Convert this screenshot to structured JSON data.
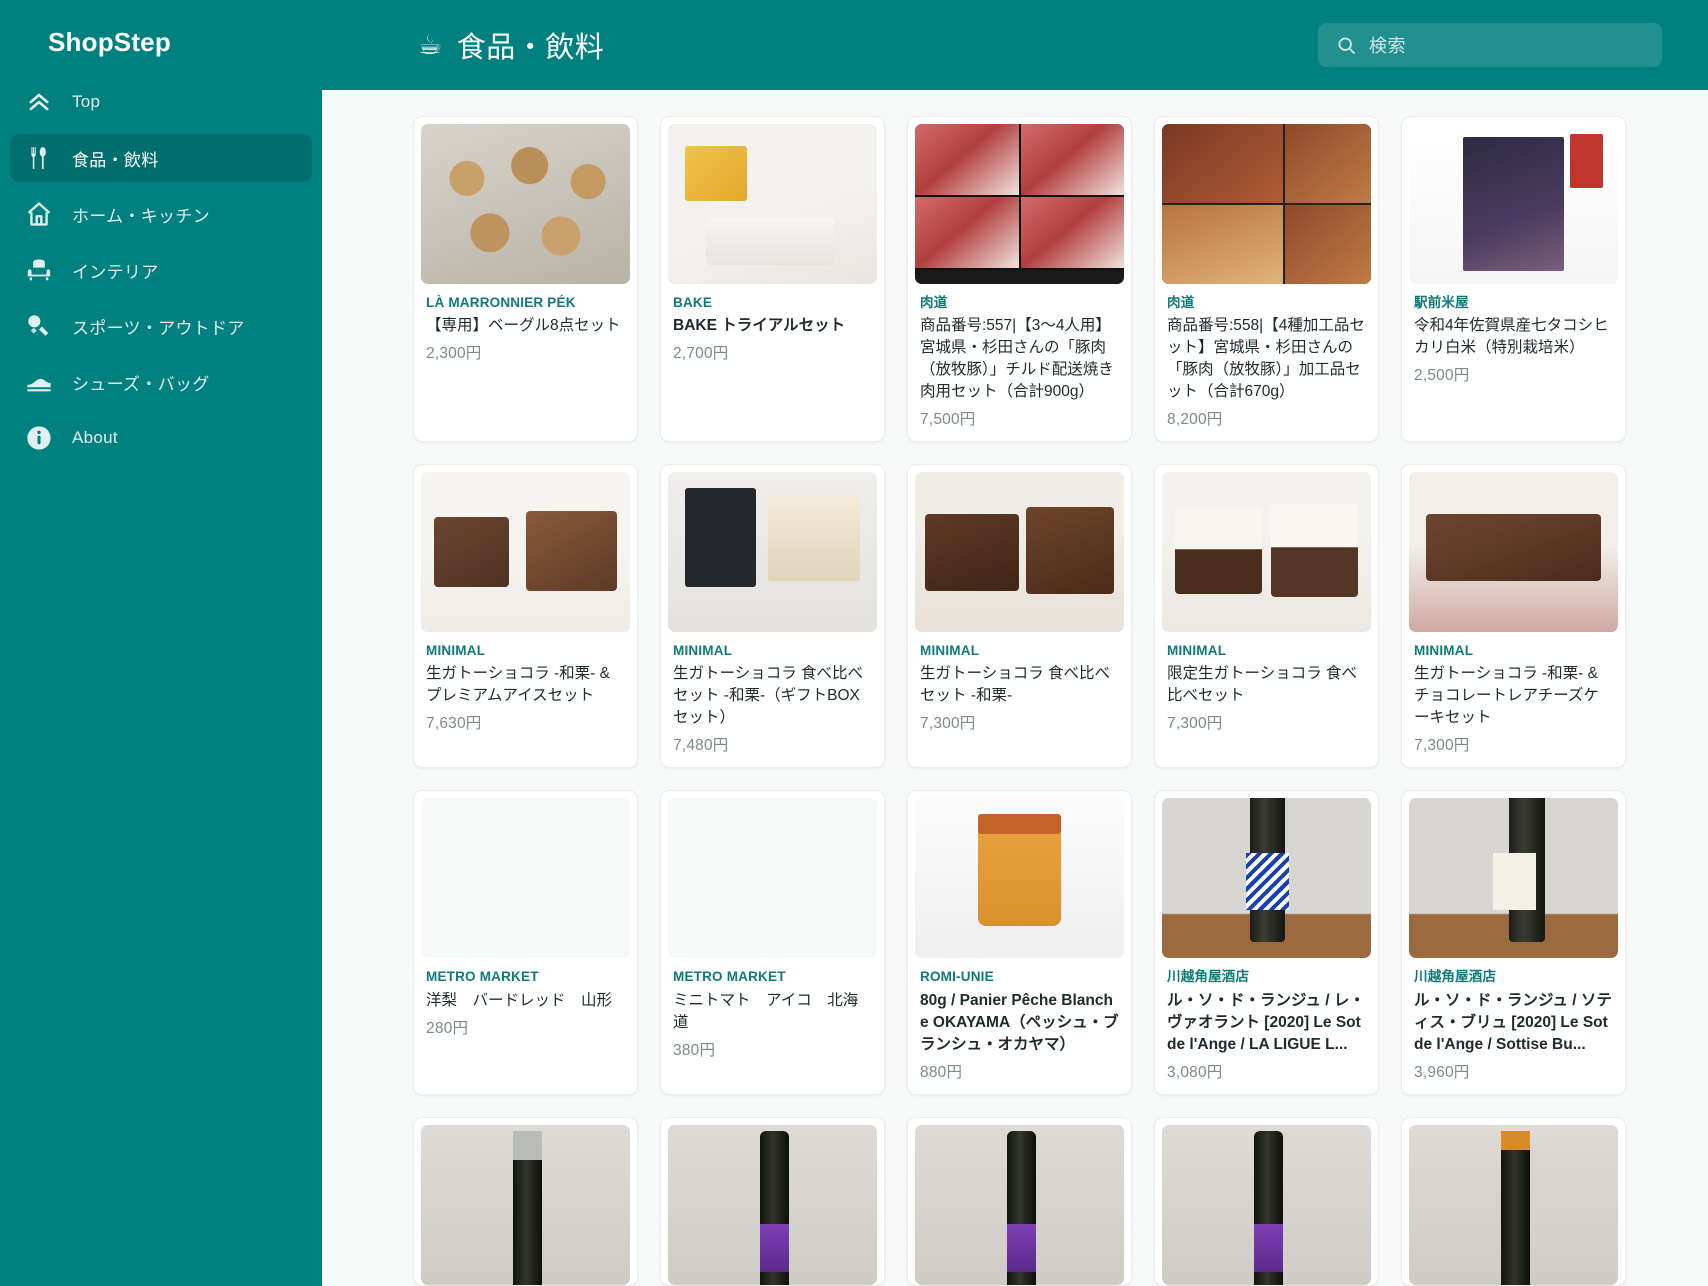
{
  "sidebar": {
    "brand": "ShopStep",
    "items": [
      {
        "label": "Top",
        "icon": "chevrons-up-icon",
        "active": false
      },
      {
        "label": "食品・飲料",
        "icon": "fork-spoon-icon",
        "active": true
      },
      {
        "label": "ホーム・キッチン",
        "icon": "home-icon",
        "active": false
      },
      {
        "label": "インテリア",
        "icon": "armchair-icon",
        "active": false
      },
      {
        "label": "スポーツ・アウトドア",
        "icon": "sports-icon",
        "active": false
      },
      {
        "label": "シューズ・バッグ",
        "icon": "shoe-icon",
        "active": false
      },
      {
        "label": "About",
        "icon": "info-icon",
        "active": false
      }
    ]
  },
  "header": {
    "title": "食品・飲料",
    "title_emoji": "☕",
    "search": {
      "placeholder": "検索",
      "value": "",
      "icon": "search-icon"
    }
  },
  "products": [
    {
      "shop": "LÀ MARRONNIER PÉK",
      "name": "【専用】ベーグル8点セット",
      "price": "2,300円",
      "bold": false,
      "art": "bagels"
    },
    {
      "shop": "BAKE",
      "name": "BAKE トライアルセット",
      "price": "2,700円",
      "bold": true,
      "art": "bake"
    },
    {
      "shop": "肉道",
      "name": "商品番号:557|【3〜4人用】宮城県・杉田さんの「豚肉（放牧豚）」チルド配送焼き肉用セット（合計900g）",
      "price": "7,500円",
      "bold": false,
      "art": "meat"
    },
    {
      "shop": "肉道",
      "name": "商品番号:558|【4種加工品セット】宮城県・杉田さんの「豚肉（放牧豚）」加工品セット（合計670g）",
      "price": "8,200円",
      "bold": false,
      "art": "sausage"
    },
    {
      "shop": "駅前米屋",
      "name": "令和4年佐賀県産七タコシヒカリ白米（特別栽培米）",
      "price": "2,500円",
      "bold": false,
      "art": "rice"
    },
    {
      "shop": "MINIMAL",
      "name": "生ガトーショコラ -和栗- & プレミアムアイスセット",
      "price": "7,630円",
      "bold": false,
      "art": "gateau1"
    },
    {
      "shop": "MINIMAL",
      "name": "生ガトーショコラ 食べ比べセット -和栗-（ギフトBOXセット）",
      "price": "7,480円",
      "bold": false,
      "art": "giftbox"
    },
    {
      "shop": "MINIMAL",
      "name": "生ガトーショコラ 食べ比べセット -和栗-",
      "price": "7,300円",
      "bold": false,
      "art": "choco"
    },
    {
      "shop": "MINIMAL",
      "name": "限定生ガトーショコラ 食べ比べセット",
      "price": "7,300円",
      "bold": false,
      "art": "cheesecake"
    },
    {
      "shop": "MINIMAL",
      "name": "生ガトーショコラ -和栗- & チョコレートレアチーズケーキセット",
      "price": "7,300円",
      "bold": false,
      "art": "rarecheese"
    },
    {
      "shop": "METRO MARKET",
      "name": "洋梨　バードレッド　山形",
      "price": "280円",
      "bold": false,
      "art": "blank"
    },
    {
      "shop": "METRO MARKET",
      "name": "ミニトマト　アイコ　北海道",
      "price": "380円",
      "bold": false,
      "art": "blank"
    },
    {
      "shop": "ROMI-UNIE",
      "name": "80g / Panier Pêche Blanche OKAYAMA（ペッシュ・ブランシュ・オカヤマ）",
      "price": "880円",
      "bold": true,
      "art": "jam"
    },
    {
      "shop": "川越角屋酒店",
      "name": "ル・ソ・ド・ランジュ / レ・ヴァオラント [2020]  Le Sot de l'Ange / LA LIGUE L...",
      "price": "3,080円",
      "bold": true,
      "art": "wine-blue"
    },
    {
      "shop": "川越角屋酒店",
      "name": "ル・ソ・ド・ランジュ / ソティス・ブリュ [2020]  Le Sot de l'Ange / Sottise Bu...",
      "price": "3,960円",
      "bold": true,
      "art": "wine-white"
    },
    {
      "shop": "",
      "name": "",
      "price": "",
      "bold": false,
      "art": "wine-tall-plain"
    },
    {
      "shop": "",
      "name": "",
      "price": "",
      "bold": false,
      "art": "wine-tall-purple"
    },
    {
      "shop": "",
      "name": "",
      "price": "",
      "bold": false,
      "art": "wine-tall-purple"
    },
    {
      "shop": "",
      "name": "",
      "price": "",
      "bold": false,
      "art": "wine-tall-purple"
    },
    {
      "shop": "",
      "name": "",
      "price": "",
      "bold": false,
      "art": "wine-tall-orange"
    }
  ],
  "colors": {
    "brand_teal": "#00807f",
    "active_teal": "#006f6e",
    "shop_link": "#0f7a78",
    "content_bg": "#f7f9f9",
    "card_bg": "#ffffff",
    "price_gray": "#7c8a8a"
  }
}
